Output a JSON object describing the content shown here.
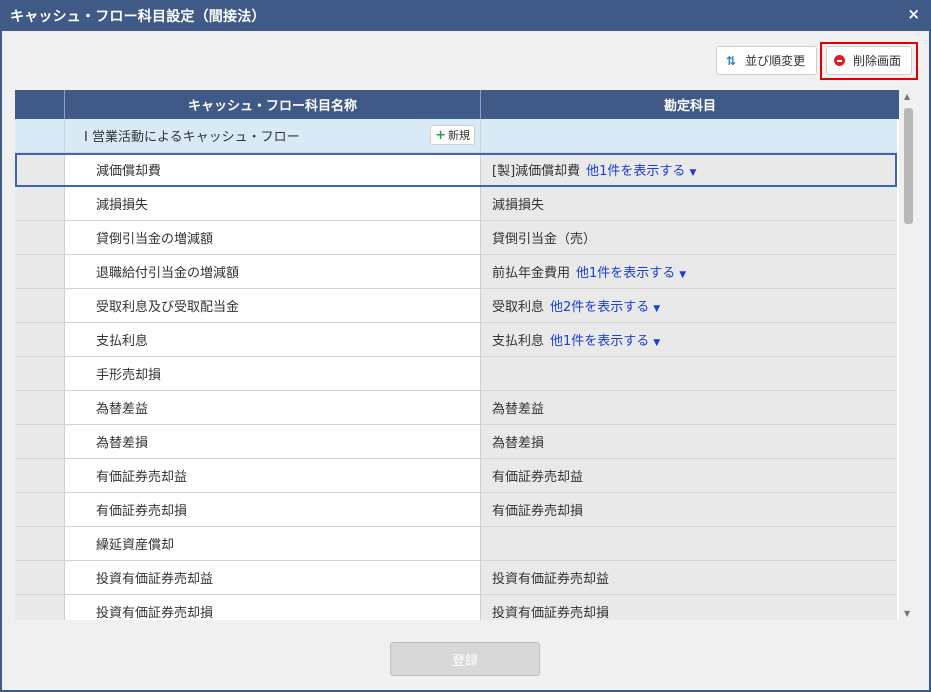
{
  "window": {
    "title": "キャッシュ・フロー科目設定（間接法）",
    "close": "×"
  },
  "toolbar": {
    "sort_label": "並び順変更",
    "sort_icon": "⇅",
    "delete_label": "削除画面"
  },
  "table": {
    "headers": [
      "",
      "キャッシュ・フロー科目名称",
      "勘定科目"
    ],
    "section": {
      "label": "Ⅰ 営業活動によるキャッシュ・フロー",
      "new_button": "新規"
    },
    "rows": [
      {
        "name": "減価償却費",
        "account": "[製]減価償却費",
        "more": "他1件を表示する",
        "selected": true
      },
      {
        "name": "減損損失",
        "account": "減損損失",
        "more": ""
      },
      {
        "name": "貸倒引当金の増減額",
        "account": "貸倒引当金（売）",
        "more": ""
      },
      {
        "name": "退職給付引当金の増減額",
        "account": "前払年金費用",
        "more": "他1件を表示する"
      },
      {
        "name": "受取利息及び受取配当金",
        "account": "受取利息",
        "more": "他2件を表示する"
      },
      {
        "name": "支払利息",
        "account": "支払利息",
        "more": "他1件を表示する"
      },
      {
        "name": "手形売却損",
        "account": "",
        "more": ""
      },
      {
        "name": "為替差益",
        "account": "為替差益",
        "more": ""
      },
      {
        "name": "為替差損",
        "account": "為替差損",
        "more": ""
      },
      {
        "name": "有価証券売却益",
        "account": "有価証券売却益",
        "more": ""
      },
      {
        "name": "有価証券売却損",
        "account": "有価証券売却損",
        "more": ""
      },
      {
        "name": "繰延資産償却",
        "account": "",
        "more": ""
      },
      {
        "name": "投資有価証券売却益",
        "account": "投資有価証券売却益",
        "more": ""
      },
      {
        "name": "投資有価証券売却損",
        "account": "投資有価証券売却損",
        "more": ""
      }
    ]
  },
  "footer": {
    "register_label": "登録"
  },
  "colors": {
    "header_bg": "#3f5a87",
    "section_bg": "#d7eaf5",
    "link": "#1a3fd1",
    "highlight": "#e10000"
  }
}
